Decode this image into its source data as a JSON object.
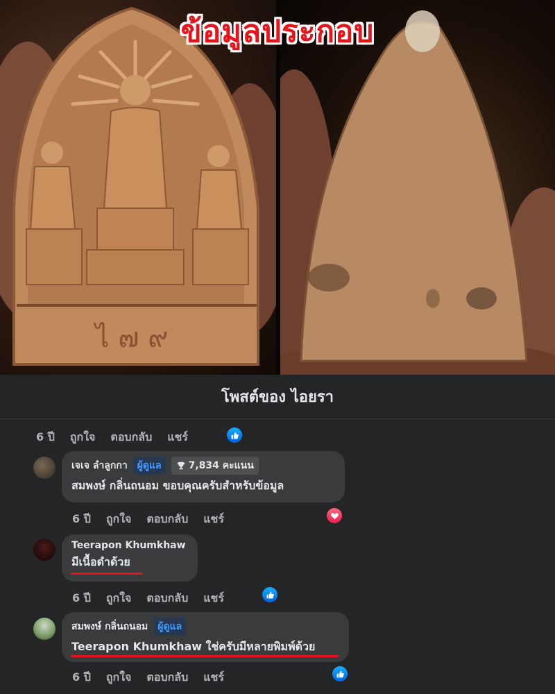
{
  "image": {
    "overlay_title": "ข้อมูลประกอบ",
    "left_photo_inscription": "ไ ๗ ๙"
  },
  "post_header": {
    "title": "โพสต์ของ ไอยรา"
  },
  "actions": {
    "time": "6 ปี",
    "like": "ถูกใจ",
    "reply": "ตอบกลับ",
    "share": "แชร์"
  },
  "comments": [
    {
      "author": "เจเจ ลำลูกกา",
      "admin_badge": "ผู้ดูแล",
      "points_badge": "7,834 คะแนน",
      "mention": "สมพงษ์ กลิ่นถนอม",
      "text": "ขอบคุณครับสำหรับข้อมูล",
      "reaction": "love-icon"
    },
    {
      "author": "Teerapon Khumkhaw",
      "text": "มีเนื้อดำด้วย",
      "reaction": "like-icon"
    },
    {
      "author": "สมพงษ์ กลิ่นถนอม",
      "admin_badge": "ผู้ดูแล",
      "mention": "Teerapon Khumkhaw",
      "text": "ใช่ครับมีหลายพิมพ์ด้วย",
      "reaction": "like-icon"
    }
  ],
  "colors": {
    "accent_blue": "#1877f2",
    "underline_red": "#e5121b",
    "title_red": "#e8141c"
  }
}
